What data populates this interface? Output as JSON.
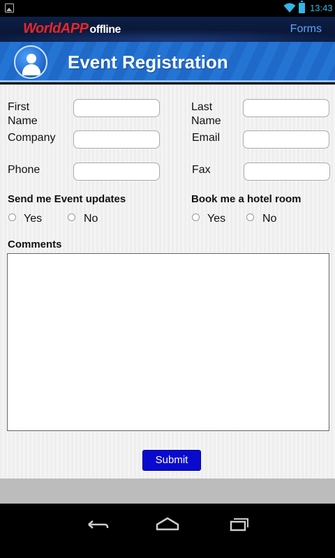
{
  "status_bar": {
    "time": "13:43"
  },
  "app_bar": {
    "brand": "WorldAPP",
    "brand_suffix": "offline",
    "forms_link": "Forms"
  },
  "header": {
    "title": "Event Registration"
  },
  "form": {
    "first_name_label": "First Name",
    "last_name_label": "Last Name",
    "company_label": "Company",
    "email_label": "Email",
    "phone_label": "Phone",
    "fax_label": "Fax",
    "event_updates": {
      "label": "Send me Event updates",
      "yes": "Yes",
      "no": "No"
    },
    "hotel_room": {
      "label": "Book me a hotel room",
      "yes": "Yes",
      "no": "No"
    },
    "comments_label": "Comments",
    "submit_label": "Submit"
  },
  "icons": {
    "status_left": "image-icon",
    "wifi": "wifi-icon",
    "battery": "battery-icon",
    "avatar": "user-avatar-icon",
    "nav_back": "back-icon",
    "nav_home": "home-icon",
    "nav_recents": "recent-apps-icon"
  }
}
